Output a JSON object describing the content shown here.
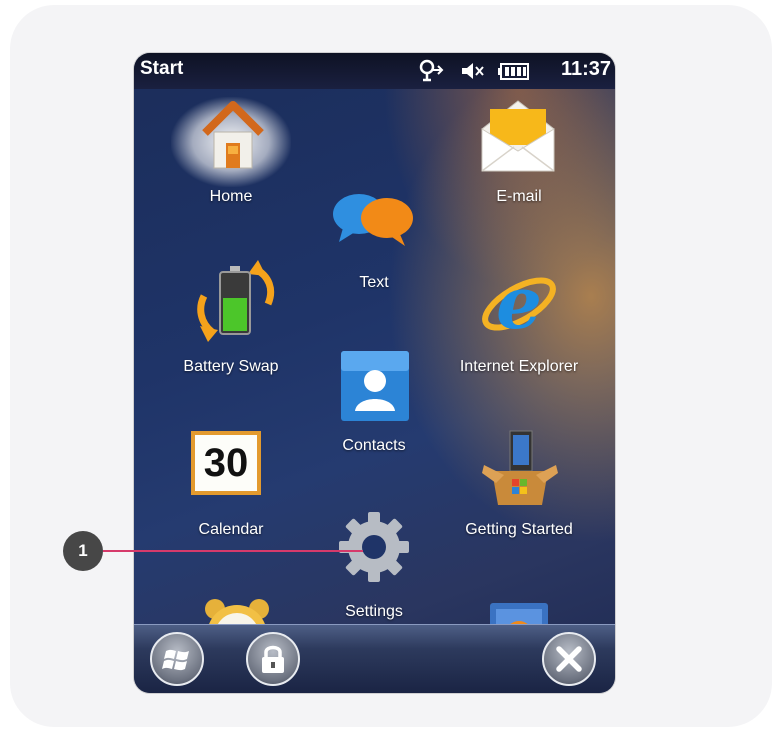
{
  "statusbar": {
    "title": "Start",
    "time": "11:37",
    "icons": [
      "connectivity-icon",
      "speaker-muted-icon",
      "battery-icon"
    ]
  },
  "tiles": [
    {
      "label": "Home",
      "icon": "house-icon"
    },
    {
      "label": "Text",
      "icon": "speech-bubbles-icon"
    },
    {
      "label": "E-mail",
      "icon": "envelope-icon"
    },
    {
      "label": "Battery Swap",
      "icon": "battery-swap-icon"
    },
    {
      "label": "Contacts",
      "icon": "contact-card-icon"
    },
    {
      "label": "Internet Explorer",
      "icon": "internet-explorer-icon"
    },
    {
      "label": "Calendar",
      "icon": "calendar-icon",
      "date": "30"
    },
    {
      "label": "Settings",
      "icon": "gear-icon"
    },
    {
      "label": "Getting Started",
      "icon": "getting-started-icon"
    },
    {
      "label": "",
      "icon": "alarm-clock-icon"
    },
    {
      "label": "",
      "icon": "media-player-icon"
    }
  ],
  "taskbar": {
    "buttons": [
      "windows-start-icon",
      "lock-icon",
      "close-icon"
    ]
  },
  "callout": {
    "number": "1"
  }
}
